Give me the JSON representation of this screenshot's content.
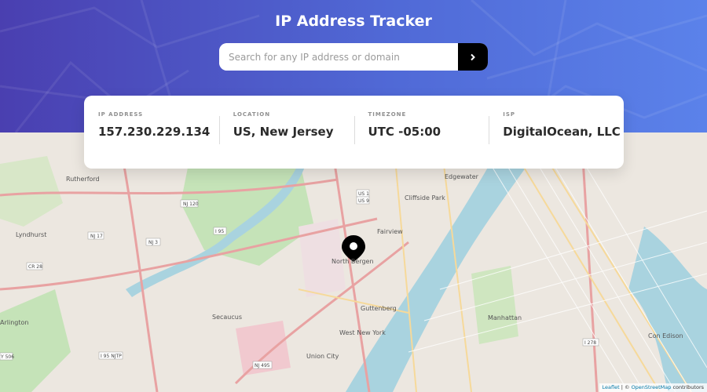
{
  "header": {
    "title": "IP Address Tracker",
    "search_placeholder": "Search for any IP address or domain",
    "search_value": "",
    "submit_icon": "chevron-right-icon"
  },
  "stats": [
    {
      "label": "IP ADDRESS",
      "value": "157.230.229.134"
    },
    {
      "label": "LOCATION",
      "value": "US, New Jersey"
    },
    {
      "label": "TIMEZONE",
      "value": "UTC -05:00"
    },
    {
      "label": "ISP",
      "value": "DigitalOcean, LLC"
    }
  ],
  "map": {
    "marker_icon": "location-pin-icon",
    "marker_place": "North Bergen",
    "places": [
      "Rutherford",
      "Lyndhurst",
      "Edgewater",
      "Cliffside Park",
      "Fairview",
      "Guttenberg",
      "West New York",
      "Union City",
      "Secaucus",
      "Manhattan",
      "Arlington",
      "Con Edison"
    ],
    "road_badges": [
      "NJ 120",
      "NJ 17",
      "NJ 3",
      "I 95",
      "US 1",
      "US 9",
      "CR 28",
      "NJ 495",
      "I 278",
      "I 95 NJTP",
      "Y 506"
    ],
    "attribution": {
      "leaflet": "Leaflet",
      "separator": " | © ",
      "osm": "OpenStreetMap",
      "suffix": " contributors"
    }
  },
  "colors": {
    "header_start": "#4a3fb0",
    "header_end": "#5b82ea",
    "button": "#000000",
    "water": "#a9d3df",
    "park": "#c5e3b8"
  }
}
